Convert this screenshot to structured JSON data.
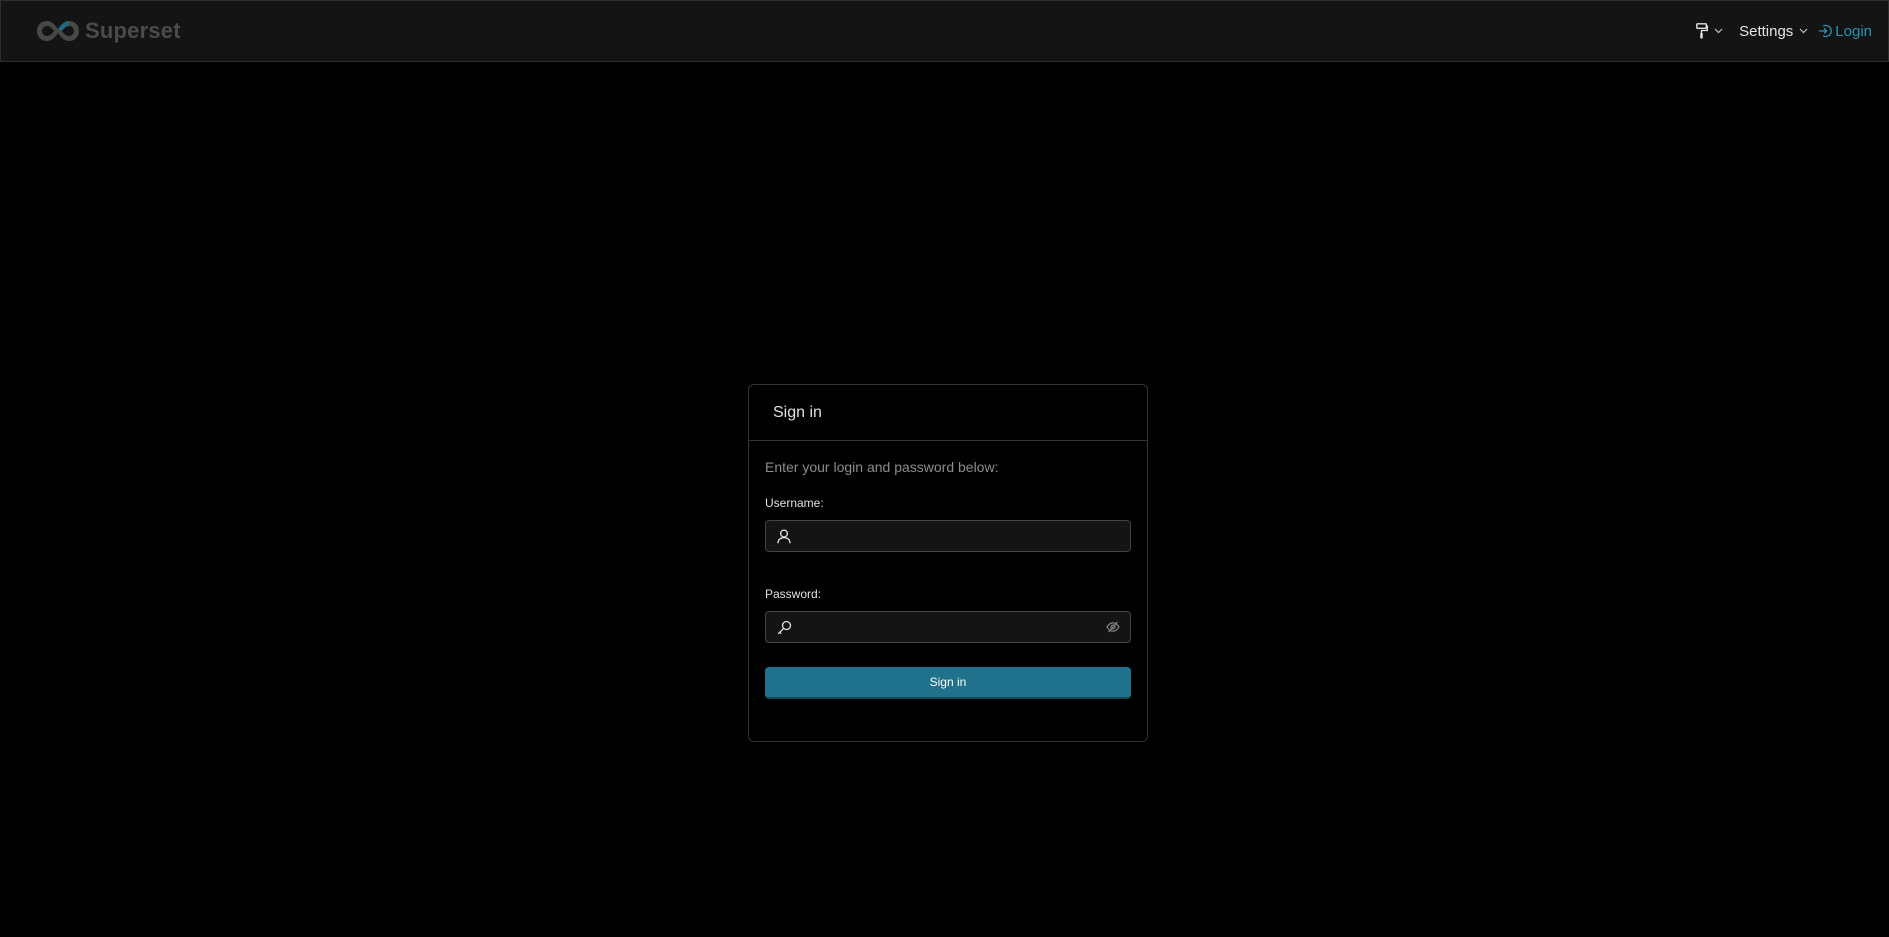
{
  "navbar": {
    "brand_name": "Superset",
    "brand_icon": "superset-logo",
    "theme_icon": "paint-roller-icon",
    "settings_label": "Settings",
    "login_label": "Login",
    "login_icon": "login-icon"
  },
  "login_card": {
    "title": "Sign in",
    "subtitle": "Enter your login and password below:",
    "username_label": "Username:",
    "username_value": "",
    "username_icon": "user-icon",
    "password_label": "Password:",
    "password_value": "",
    "password_icon": "key-icon",
    "password_toggle_icon": "eye-invisible-icon",
    "submit_label": "Sign in"
  },
  "colors": {
    "background": "#000000",
    "navbar": "#141414",
    "accent": "#20718b",
    "link": "#2893b3"
  }
}
